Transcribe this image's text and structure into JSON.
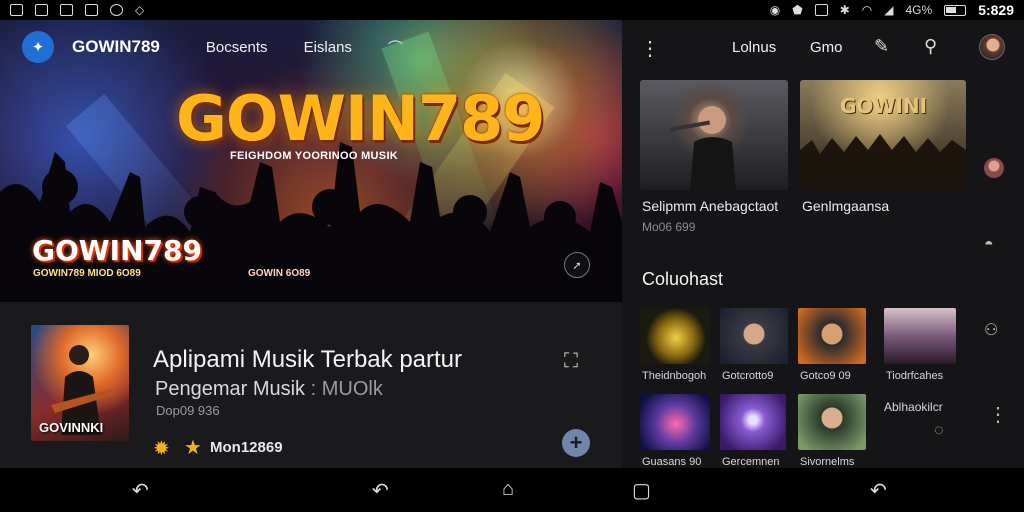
{
  "status_bar": {
    "time": "5:829",
    "signal": "4G%"
  },
  "left_nav": {
    "logo_text": "GOWIN789",
    "links": [
      "Bocsents",
      "Eislans"
    ]
  },
  "hero": {
    "title": "GOWIN789",
    "subtitle": "FEIGHDOM YOORINOO MUSIK",
    "logo2": "GOWIN789",
    "tag": "GOWIN789 MIOD 6O89",
    "tag2": "GOWIN 6O89"
  },
  "now_playing": {
    "art_label": "GOVINNKI",
    "title": "Aplipami Musik Terbak partur",
    "subtitle": "Pengemar Musik",
    "subtitle_muted": ": MUOlk",
    "meta": "Dop09 936",
    "rating": "Mon12869"
  },
  "right_nav": {
    "links": [
      "Lolnus",
      "Gmo"
    ]
  },
  "featured": [
    {
      "title": "Selipmm Anebagctaot",
      "meta": "Mo06 699"
    },
    {
      "title": "Genlmgaansa",
      "meta": "",
      "image_text": "GOWINI"
    }
  ],
  "section_title": "Coluohast",
  "tiles": [
    {
      "label": "Theidnbogoh"
    },
    {
      "label": "Gotcrotto9"
    },
    {
      "label": "Gotco9 09"
    },
    {
      "label": "Tiodrfcahes"
    },
    {
      "label": "Guasans 90"
    },
    {
      "label": "Gercemnen"
    },
    {
      "label": "Sivornelms"
    }
  ],
  "side_label": "Ablhaokilcr"
}
